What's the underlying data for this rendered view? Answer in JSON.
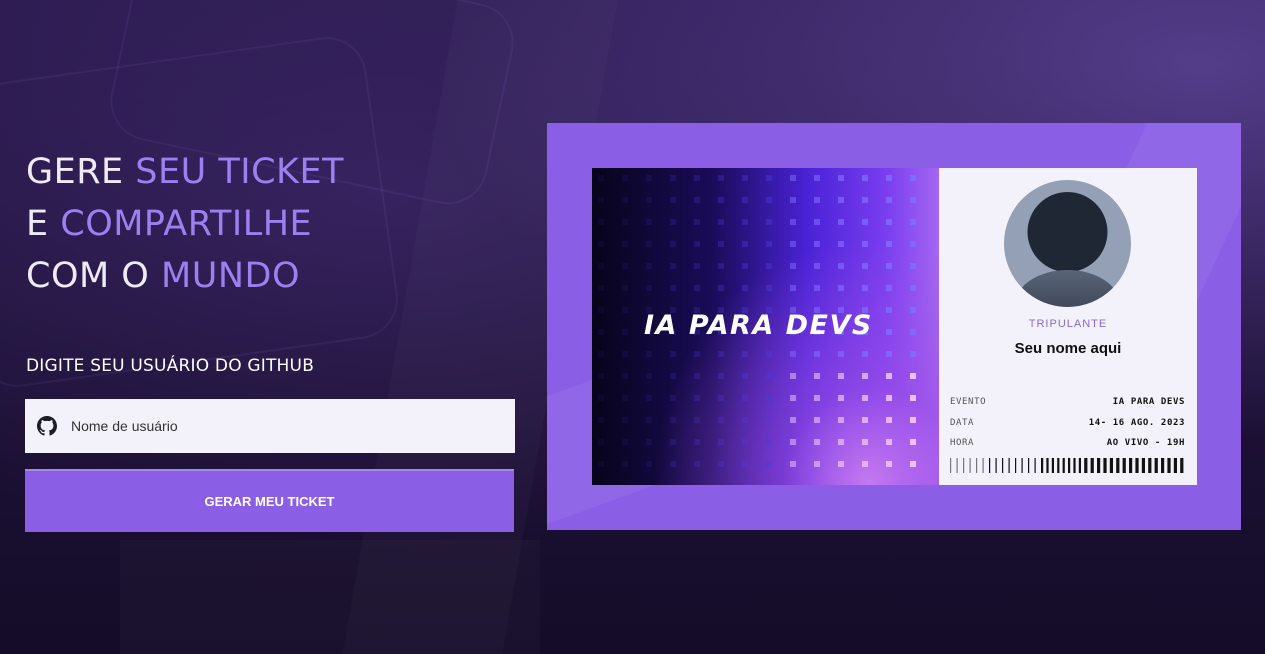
{
  "headline": {
    "line1_a": "GERE ",
    "line1_b": "SEU TICKET",
    "line2_a": "E ",
    "line2_b": "COMPARTILHE",
    "line3_a": "COM O ",
    "line3_b": "MUNDO"
  },
  "form": {
    "label": "DIGITE SEU USUÁRIO DO GITHUB",
    "input_placeholder": "Nome de usuário",
    "input_value": "",
    "button_label": "GERAR MEU TICKET"
  },
  "ticket": {
    "brand": "IA PARA DEVS",
    "role_label": "TRIPULANTE",
    "name": "Seu nome aqui",
    "info": [
      {
        "key": "EVENTO",
        "value": "IA PARA DEVS"
      },
      {
        "key": "DATA",
        "value": "14- 16 AGO. 2023"
      },
      {
        "key": "HORA",
        "value": "AO VIVO - 19H"
      }
    ]
  },
  "icons": {
    "github": "github-icon",
    "avatar": "user-avatar-icon",
    "barcode": "barcode-icon"
  },
  "colors": {
    "accent": "#8a5fe6",
    "accent_light": "#9d7ff0",
    "background": "#1e1238",
    "input_bg": "#f3f2fa"
  }
}
